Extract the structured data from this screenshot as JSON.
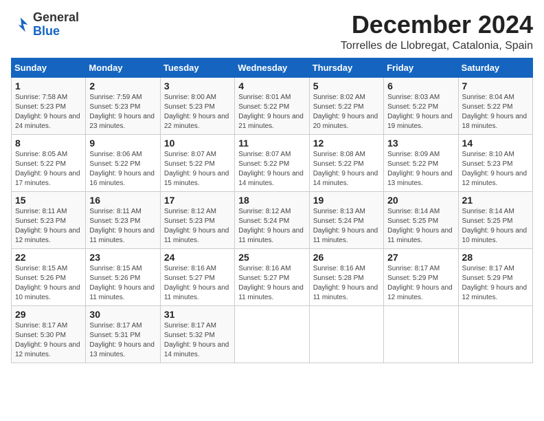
{
  "logo": {
    "general": "General",
    "blue": "Blue"
  },
  "title": "December 2024",
  "location": "Torrelles de Llobregat, Catalonia, Spain",
  "header": {
    "days": [
      "Sunday",
      "Monday",
      "Tuesday",
      "Wednesday",
      "Thursday",
      "Friday",
      "Saturday"
    ]
  },
  "weeks": [
    [
      {
        "day": "1",
        "sunrise": "7:58 AM",
        "sunset": "5:23 PM",
        "daylight": "9 hours and 24 minutes."
      },
      {
        "day": "2",
        "sunrise": "7:59 AM",
        "sunset": "5:23 PM",
        "daylight": "9 hours and 23 minutes."
      },
      {
        "day": "3",
        "sunrise": "8:00 AM",
        "sunset": "5:23 PM",
        "daylight": "9 hours and 22 minutes."
      },
      {
        "day": "4",
        "sunrise": "8:01 AM",
        "sunset": "5:22 PM",
        "daylight": "9 hours and 21 minutes."
      },
      {
        "day": "5",
        "sunrise": "8:02 AM",
        "sunset": "5:22 PM",
        "daylight": "9 hours and 20 minutes."
      },
      {
        "day": "6",
        "sunrise": "8:03 AM",
        "sunset": "5:22 PM",
        "daylight": "9 hours and 19 minutes."
      },
      {
        "day": "7",
        "sunrise": "8:04 AM",
        "sunset": "5:22 PM",
        "daylight": "9 hours and 18 minutes."
      }
    ],
    [
      {
        "day": "8",
        "sunrise": "8:05 AM",
        "sunset": "5:22 PM",
        "daylight": "9 hours and 17 minutes."
      },
      {
        "day": "9",
        "sunrise": "8:06 AM",
        "sunset": "5:22 PM",
        "daylight": "9 hours and 16 minutes."
      },
      {
        "day": "10",
        "sunrise": "8:07 AM",
        "sunset": "5:22 PM",
        "daylight": "9 hours and 15 minutes."
      },
      {
        "day": "11",
        "sunrise": "8:07 AM",
        "sunset": "5:22 PM",
        "daylight": "9 hours and 14 minutes."
      },
      {
        "day": "12",
        "sunrise": "8:08 AM",
        "sunset": "5:22 PM",
        "daylight": "9 hours and 14 minutes."
      },
      {
        "day": "13",
        "sunrise": "8:09 AM",
        "sunset": "5:22 PM",
        "daylight": "9 hours and 13 minutes."
      },
      {
        "day": "14",
        "sunrise": "8:10 AM",
        "sunset": "5:23 PM",
        "daylight": "9 hours and 12 minutes."
      }
    ],
    [
      {
        "day": "15",
        "sunrise": "8:11 AM",
        "sunset": "5:23 PM",
        "daylight": "9 hours and 12 minutes."
      },
      {
        "day": "16",
        "sunrise": "8:11 AM",
        "sunset": "5:23 PM",
        "daylight": "9 hours and 11 minutes."
      },
      {
        "day": "17",
        "sunrise": "8:12 AM",
        "sunset": "5:23 PM",
        "daylight": "9 hours and 11 minutes."
      },
      {
        "day": "18",
        "sunrise": "8:12 AM",
        "sunset": "5:24 PM",
        "daylight": "9 hours and 11 minutes."
      },
      {
        "day": "19",
        "sunrise": "8:13 AM",
        "sunset": "5:24 PM",
        "daylight": "9 hours and 11 minutes."
      },
      {
        "day": "20",
        "sunrise": "8:14 AM",
        "sunset": "5:25 PM",
        "daylight": "9 hours and 11 minutes."
      },
      {
        "day": "21",
        "sunrise": "8:14 AM",
        "sunset": "5:25 PM",
        "daylight": "9 hours and 10 minutes."
      }
    ],
    [
      {
        "day": "22",
        "sunrise": "8:15 AM",
        "sunset": "5:26 PM",
        "daylight": "9 hours and 10 minutes."
      },
      {
        "day": "23",
        "sunrise": "8:15 AM",
        "sunset": "5:26 PM",
        "daylight": "9 hours and 11 minutes."
      },
      {
        "day": "24",
        "sunrise": "8:16 AM",
        "sunset": "5:27 PM",
        "daylight": "9 hours and 11 minutes."
      },
      {
        "day": "25",
        "sunrise": "8:16 AM",
        "sunset": "5:27 PM",
        "daylight": "9 hours and 11 minutes."
      },
      {
        "day": "26",
        "sunrise": "8:16 AM",
        "sunset": "5:28 PM",
        "daylight": "9 hours and 11 minutes."
      },
      {
        "day": "27",
        "sunrise": "8:17 AM",
        "sunset": "5:29 PM",
        "daylight": "9 hours and 12 minutes."
      },
      {
        "day": "28",
        "sunrise": "8:17 AM",
        "sunset": "5:29 PM",
        "daylight": "9 hours and 12 minutes."
      }
    ],
    [
      {
        "day": "29",
        "sunrise": "8:17 AM",
        "sunset": "5:30 PM",
        "daylight": "9 hours and 12 minutes."
      },
      {
        "day": "30",
        "sunrise": "8:17 AM",
        "sunset": "5:31 PM",
        "daylight": "9 hours and 13 minutes."
      },
      {
        "day": "31",
        "sunrise": "8:17 AM",
        "sunset": "5:32 PM",
        "daylight": "9 hours and 14 minutes."
      },
      null,
      null,
      null,
      null
    ]
  ],
  "labels": {
    "sunrise": "Sunrise:",
    "sunset": "Sunset:",
    "daylight": "Daylight:"
  }
}
